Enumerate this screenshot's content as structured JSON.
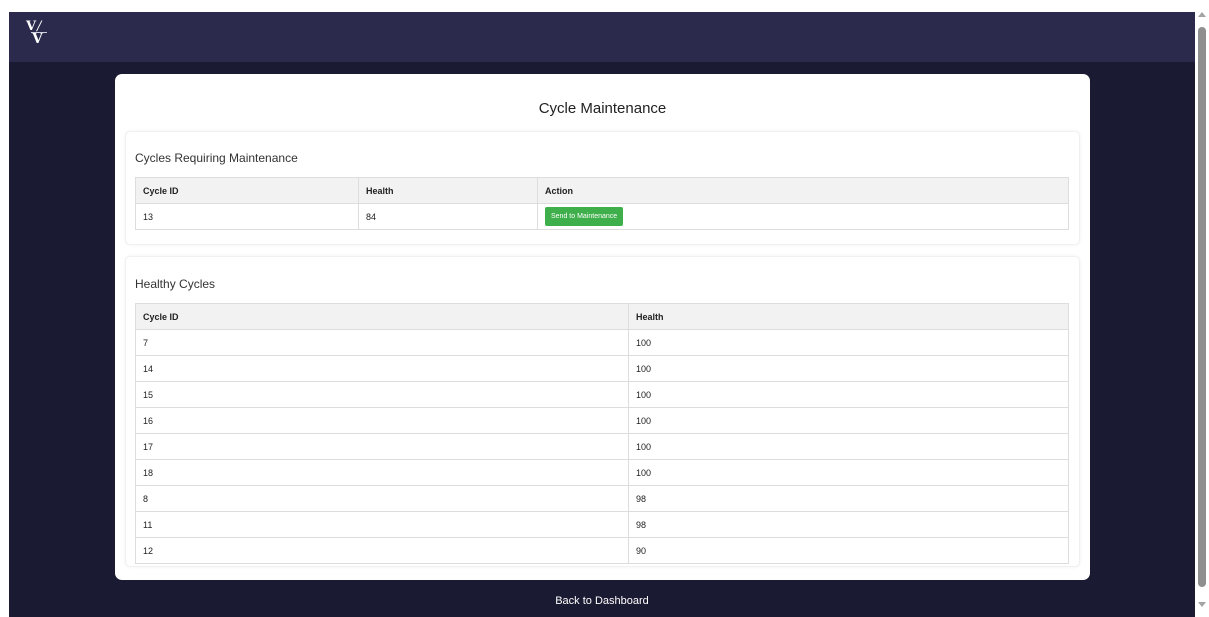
{
  "header": {
    "logo_icon": "v-monogram-logo-icon"
  },
  "page": {
    "title": "Cycle Maintenance"
  },
  "maintenance": {
    "title": "Cycles Requiring Maintenance",
    "columns": [
      "Cycle ID",
      "Health",
      "Action"
    ],
    "rows": [
      {
        "id": "13",
        "health": "84",
        "action_label": "Send to Maintenance"
      }
    ]
  },
  "healthy": {
    "title": "Healthy Cycles",
    "columns": [
      "Cycle ID",
      "Health"
    ],
    "rows": [
      {
        "id": "7",
        "health": "100"
      },
      {
        "id": "14",
        "health": "100"
      },
      {
        "id": "15",
        "health": "100"
      },
      {
        "id": "16",
        "health": "100"
      },
      {
        "id": "17",
        "health": "100"
      },
      {
        "id": "18",
        "health": "100"
      },
      {
        "id": "8",
        "health": "98"
      },
      {
        "id": "11",
        "health": "98"
      },
      {
        "id": "12",
        "health": "90"
      }
    ]
  },
  "footer": {
    "back_label": "Back to Dashboard"
  },
  "colors": {
    "background": "#1b1a33",
    "header": "#2b2a4c",
    "button": "#3eaf4a"
  }
}
